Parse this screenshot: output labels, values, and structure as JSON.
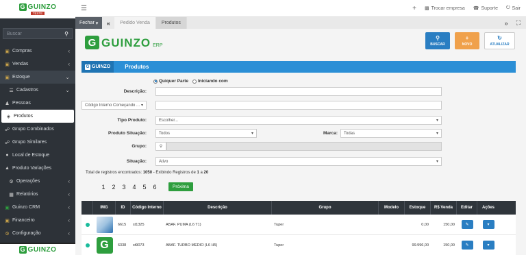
{
  "app": {
    "logo_text": "GUINZO",
    "logo_sub": "TESTE",
    "brand_text": "GUINZO",
    "brand_erp": "ERP"
  },
  "sidebar": {
    "search_placeholder": "Buscar",
    "items": [
      {
        "label": "Compras",
        "icon": "cart-icon",
        "chevron": "‹"
      },
      {
        "label": "Vendas",
        "icon": "sales-icon",
        "chevron": "‹"
      },
      {
        "label": "Estoque",
        "icon": "box-icon",
        "chevron": "⌄"
      },
      {
        "label": "Cadastros",
        "icon": "list-icon",
        "chevron": "⌄"
      },
      {
        "label": "Pessoas",
        "icon": "people-icon",
        "chevron": ""
      },
      {
        "label": "Produtos",
        "icon": "tag-icon",
        "chevron": ""
      },
      {
        "label": "Grupo Combinados",
        "icon": "group-icon",
        "chevron": ""
      },
      {
        "label": "Grupo Similares",
        "icon": "group-icon",
        "chevron": ""
      },
      {
        "label": "Local de Estoque",
        "icon": "location-icon",
        "chevron": ""
      },
      {
        "label": "Produto Variações",
        "icon": "variations-icon",
        "chevron": ""
      },
      {
        "label": "Operações",
        "icon": "gear-icon",
        "chevron": "‹"
      },
      {
        "label": "Relatórios",
        "icon": "report-icon",
        "chevron": "‹"
      },
      {
        "label": "Guinzo CRM",
        "icon": "crm-icon",
        "chevron": "‹"
      },
      {
        "label": "Financeiro",
        "icon": "money-icon",
        "chevron": "‹"
      },
      {
        "label": "Configuração",
        "icon": "gear-icon",
        "chevron": "‹"
      }
    ]
  },
  "topbar": {
    "trocar_empresa": "Trocar empresa",
    "suporte": "Suporte",
    "sair": "Sair"
  },
  "tabs": {
    "fechar": "Fechar",
    "items": [
      "Pedido Venda",
      "Produtos"
    ]
  },
  "actions": {
    "buscar": "BUSCAR",
    "novo": "NOVO",
    "atualizar": "ATUALIZAR"
  },
  "panel": {
    "logo": "GUINZO",
    "title": "Produtos"
  },
  "form": {
    "radio_qualquer": "Quiquer Parte",
    "radio_iniciando": "Iniciando com",
    "descricao_label": "Descrição:",
    "codigo_select": "Código Interno Começando ...",
    "tipo_label": "Tipo Produto:",
    "tipo_value": "Escolher...",
    "situacao_prod_label": "Produto Situação:",
    "situacao_prod_value": "Todos",
    "marca_label": "Marca:",
    "marca_value": "Todas",
    "grupo_label": "Grupo:",
    "situacao_label": "Situação:",
    "situacao_value": "Ativo"
  },
  "results": {
    "total_text": "Total de registros encontrados:",
    "total_count": "1050",
    "exibindo": "- Exibindo Registros de",
    "from": "1",
    "a": "a",
    "to": "20",
    "pages": [
      "1",
      "2",
      "3",
      "4",
      "5",
      "6"
    ],
    "proxima": "Próxima"
  },
  "table": {
    "headers": [
      "",
      "IMG",
      "ID",
      "Código Interno",
      "Descrição",
      "Grupo",
      "Modelo",
      "Estoque",
      "R$ Venda",
      "Editar",
      "Ações"
    ],
    "rows": [
      {
        "id": "6615",
        "codigo": "st1325",
        "descricao": "ABAF. PUMA (L6 T1)",
        "grupo": "Tuper",
        "modelo": "",
        "estoque": "0,00",
        "venda": "150,00"
      },
      {
        "id": "6338",
        "codigo": "st9073",
        "descricao": "ABAF. TURBO MEDIO (L6 H5)",
        "grupo": "Tuper",
        "modelo": "",
        "estoque": "99.996,00",
        "venda": "150,00"
      }
    ]
  }
}
